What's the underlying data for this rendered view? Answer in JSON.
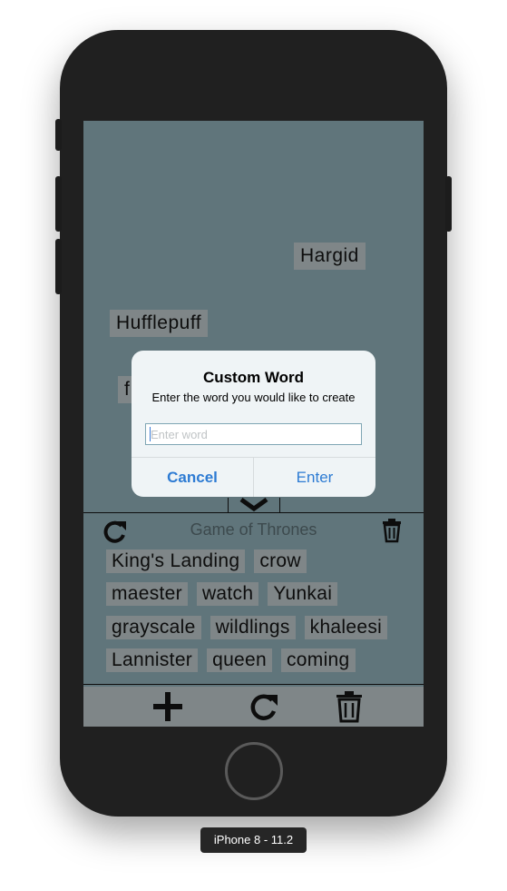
{
  "canvas": {
    "floating_words": [
      "Hargid",
      "Hufflepuff",
      "f"
    ]
  },
  "panel": {
    "title": "Game of Thrones",
    "rows": [
      [
        "King's Landing",
        "crow"
      ],
      [
        "maester",
        "watch",
        "Yunkai"
      ],
      [
        "grayscale",
        "wildlings",
        "khaleesi"
      ],
      [
        "Lannister",
        "queen",
        "coming"
      ]
    ]
  },
  "dialog": {
    "title": "Custom Word",
    "message": "Enter the word you would like to create",
    "input_value": "",
    "input_placeholder": "Enter word",
    "cancel_label": "Cancel",
    "enter_label": "Enter"
  },
  "device_label": "iPhone 8 - 11.2",
  "colors": {
    "screen_bg": "#768f96",
    "chip_bg": "#9ba4a6",
    "accent": "#2d7bd3"
  },
  "icons": {
    "panel_left": "refresh-icon",
    "panel_right": "trash-icon",
    "bar": [
      "plus-icon",
      "refresh-icon",
      "trash-icon"
    ]
  }
}
